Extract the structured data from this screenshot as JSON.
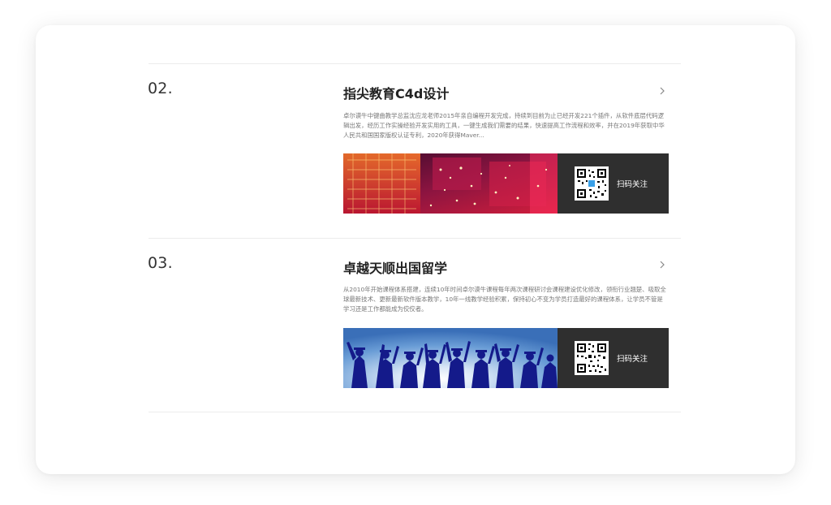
{
  "items": [
    {
      "number": "02.",
      "title": "指尖教育C4d设计",
      "description": "卓尔谟牛中键曲教学总监沈应龙老师2015年亲自编程开发完成，持续到目前为止已经开发221个插件，从软件底层代码逻辑出发，经历工作实操经验开发实用的工具，一键生成我们需要的结果，快速提高工作流程和效率，并在2019年获取中华人民共和国国家版权认证专利，2020年获得Maver...",
      "banner_image_icon": "circuit-city-image",
      "qr_icon": "qr-code-icon",
      "qr_label": "扫码关注"
    },
    {
      "number": "03.",
      "title": "卓越天顺出国留学",
      "description": "从2010年开始课程体系搭建，连续10年时间卓尔谟牛课程每年两次课程研讨会课程建设优化修改，领衔行业翘楚、吸取全球最新技术、更新最新软件版本教学，10年一线教学经验积累，保持初心不变为学员打造最好的课程体系，让学员不管是学习还是工作都能成为佼佼者。",
      "banner_image_icon": "graduates-celebrating-image",
      "qr_icon": "qr-code-icon",
      "qr_label": "扫码关注"
    }
  ],
  "colors": {
    "qr_panel_bg": "#2f2f2f",
    "title": "#222222",
    "text": "#777777",
    "divider": "#ececec"
  }
}
